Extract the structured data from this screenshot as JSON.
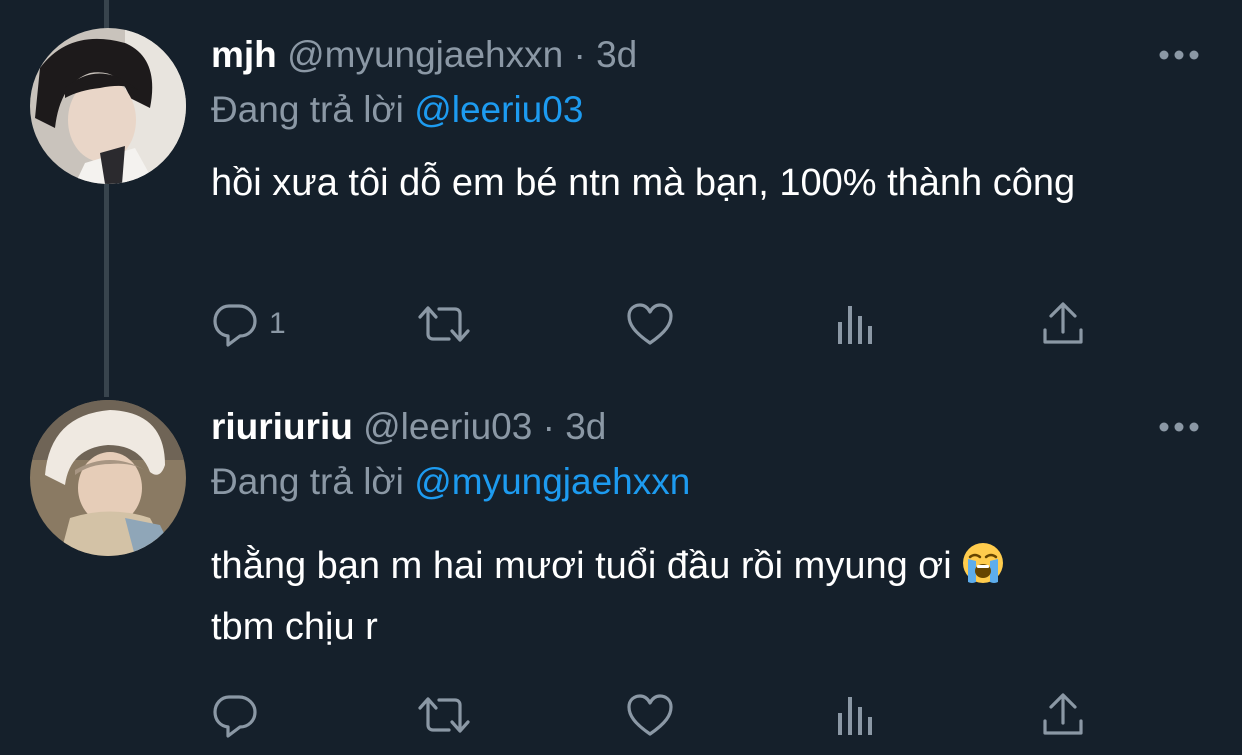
{
  "tweets": [
    {
      "display_name": "mjh",
      "handle": "@myungjaehxxn",
      "separator": "·",
      "time": "3d",
      "replying_prefix": "Đang trả lời",
      "replying_to": "@leeriu03",
      "text": "hồi xưa tôi dỗ em bé ntn mà bạn, 100% thành công",
      "reply_count": "1",
      "avatar_icon": "user-avatar-photo"
    },
    {
      "display_name": "riuriuriu",
      "handle": "@leeriu03",
      "separator": "·",
      "time": "3d",
      "replying_prefix": "Đang trả lời",
      "replying_to": "@myungjaehxxn",
      "text": "thằng bạn m hai mươi tuổi đầu rồi myung ơi",
      "text_emoji": "loudly-crying-face",
      "text_line2": "tbm chịu r",
      "reply_count": "",
      "avatar_icon": "user-avatar-photo"
    }
  ],
  "icons": {
    "reply": "reply-icon",
    "retweet": "retweet-icon",
    "like": "like-icon",
    "analytics": "analytics-icon",
    "share": "share-icon",
    "more": "more-icon"
  },
  "colors": {
    "background": "#15202b",
    "secondary_text": "#8b98a5",
    "link": "#1d9bf0",
    "thread_line": "#38444d"
  }
}
